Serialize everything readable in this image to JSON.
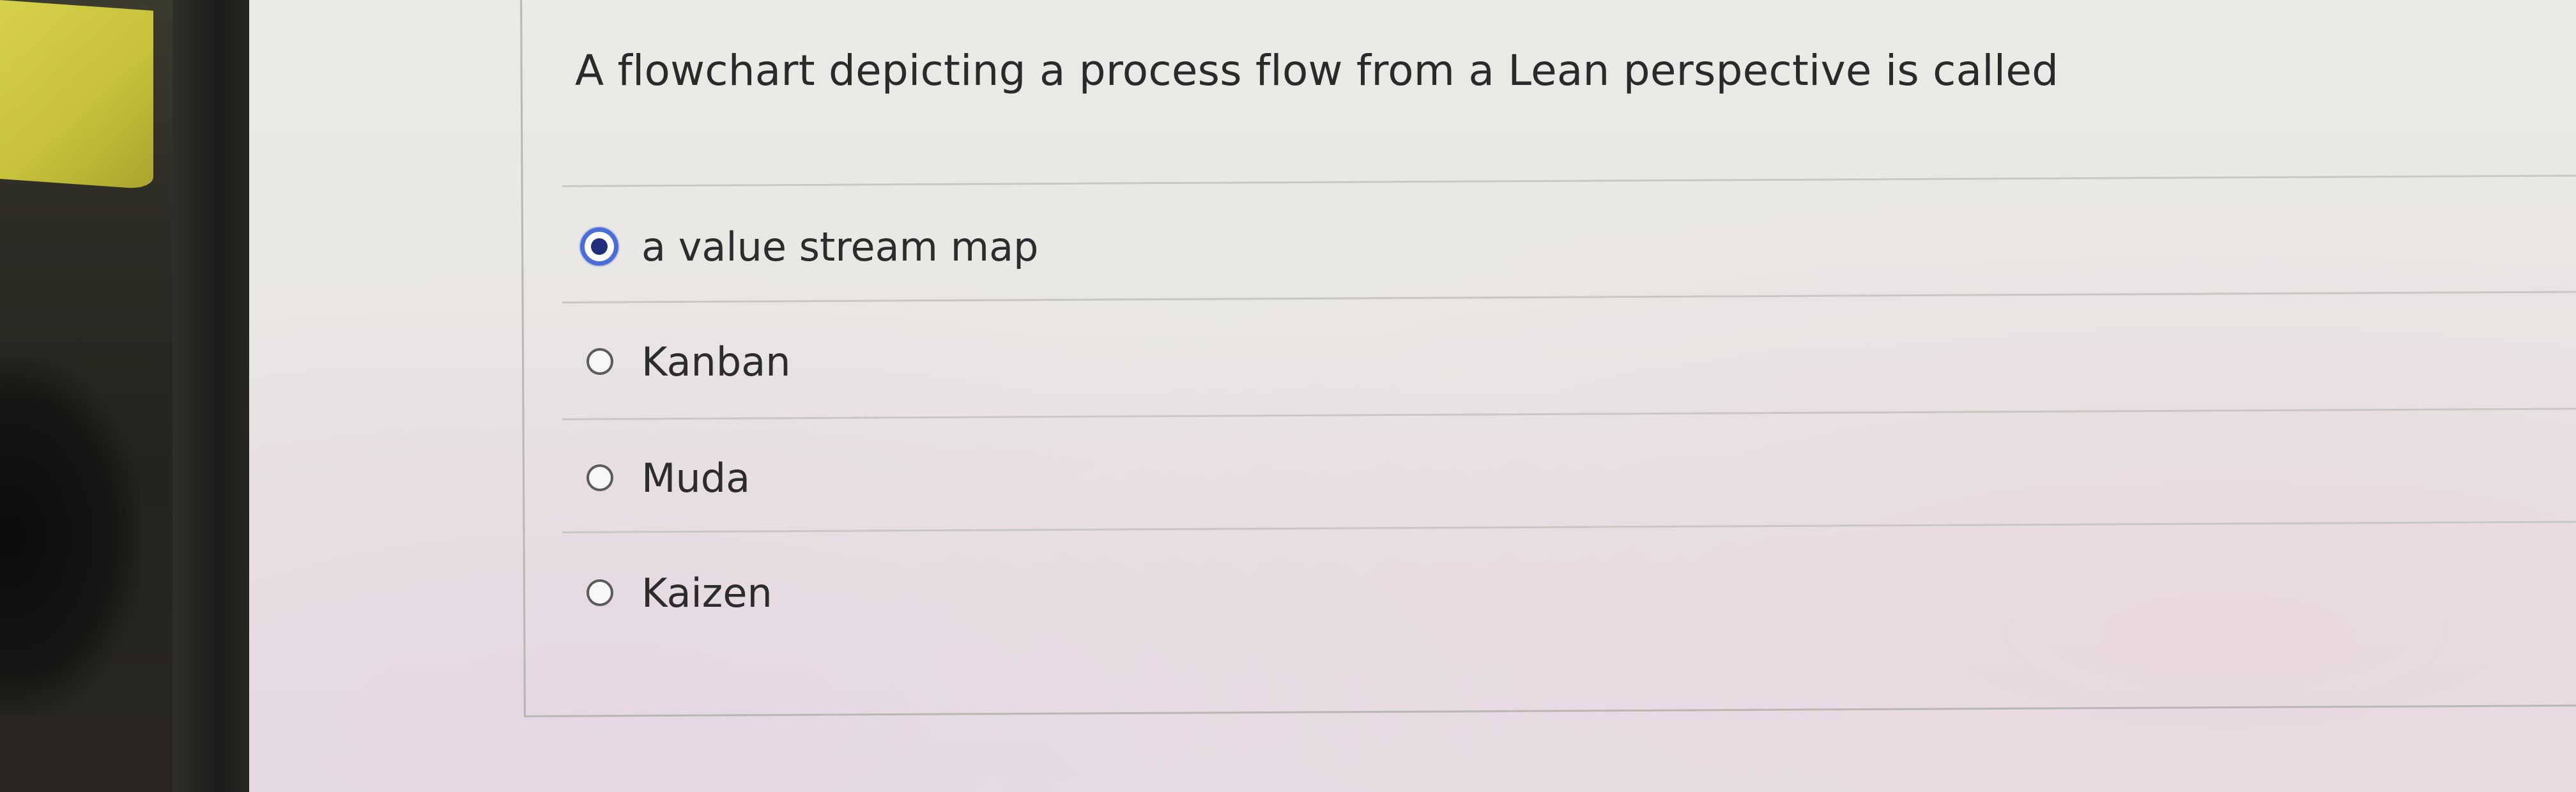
{
  "question": {
    "text": "A flowchart depicting a process flow from a Lean perspective is called"
  },
  "options": [
    {
      "label": "a value stream map",
      "selected": true
    },
    {
      "label": "Kanban",
      "selected": false
    },
    {
      "label": "Muda",
      "selected": false
    },
    {
      "label": "Kaizen",
      "selected": false
    }
  ],
  "colors": {
    "radio_selected": "#4a6ed6",
    "radio_selected_dot": "#1f2f7a",
    "text": "#2c2c2c",
    "divider": "#c9c7c4"
  }
}
